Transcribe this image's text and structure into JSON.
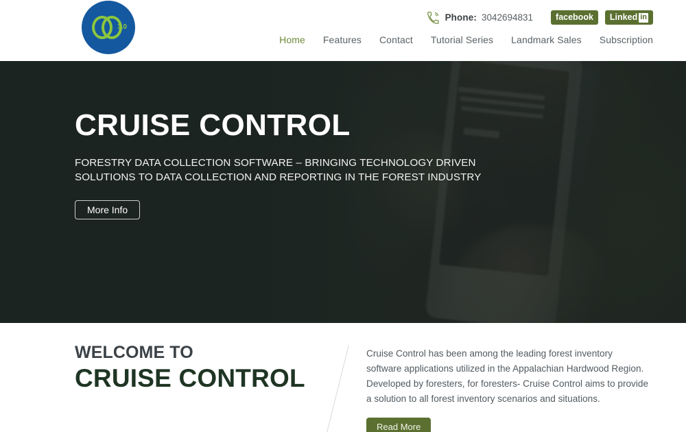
{
  "header": {
    "logo": {
      "icon": "cruise-control-logo",
      "version_text": "3.0",
      "circle_color": "#1458a0",
      "mark_color": "#8cc63e"
    },
    "phone": {
      "icon": "phone-ringing-icon",
      "label": "Phone:",
      "number": "3042694831"
    },
    "social": [
      {
        "name": "facebook",
        "label": "facebook"
      },
      {
        "name": "linkedin",
        "label": "Linked",
        "badge": "in"
      }
    ],
    "nav": [
      {
        "label": "Home",
        "active": true
      },
      {
        "label": "Features",
        "active": false
      },
      {
        "label": "Contact",
        "active": false
      },
      {
        "label": "Tutorial Series",
        "active": false
      },
      {
        "label": "Landmark Sales",
        "active": false
      },
      {
        "label": "Subscription",
        "active": false
      }
    ]
  },
  "hero": {
    "title": "CRUISE CONTROL",
    "subtitle": "FORESTRY DATA COLLECTION SOFTWARE – BRINGING TECHNOLOGY DRIVEN SOLUTIONS TO DATA COLLECTION AND REPORTING IN THE FOREST INDUSTRY",
    "button_label": "More Info",
    "background": "photo of hand holding rugged smartphone in forest, dark overlay"
  },
  "welcome": {
    "kicker": "WELCOME TO",
    "title": "CRUISE CONTROL",
    "paragraph": "Cruise Control has been among the leading forest inventory software applications utilized in the Appalachian Hardwood Region. Developed by foresters, for foresters- Cruise Control aims to provide a solution to all forest inventory scenarios and situations.",
    "button_label": "Read More"
  },
  "colors": {
    "brand_green": "#5b7030",
    "nav_active": "#6d8a3a",
    "logo_blue": "#1458a0",
    "logo_green": "#8cc63e",
    "heading_dark_green": "#1f3524",
    "hero_overlay": "#1c2421"
  }
}
